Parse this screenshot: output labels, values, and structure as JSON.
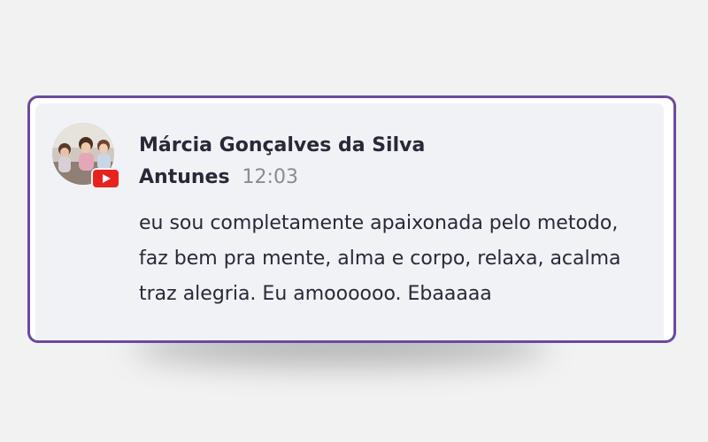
{
  "comment": {
    "author_name_line1": "Márcia Gonçalves da Silva",
    "author_name_line2": "Antunes",
    "time": "12:03",
    "message": "eu sou completamente apaixonada pelo metodo, faz bem pra mente, alma e corpo, relaxa, acalma traz alegria. Eu amoooooo. Ebaaaaa",
    "platform_icon": "youtube-icon",
    "avatar": "profile-photo",
    "colors": {
      "border": "#6b4a9b",
      "card_background": "#f1f2f6",
      "text": "#2a2838",
      "time_text": "#8a8a92",
      "youtube_red": "#e8231d"
    }
  }
}
